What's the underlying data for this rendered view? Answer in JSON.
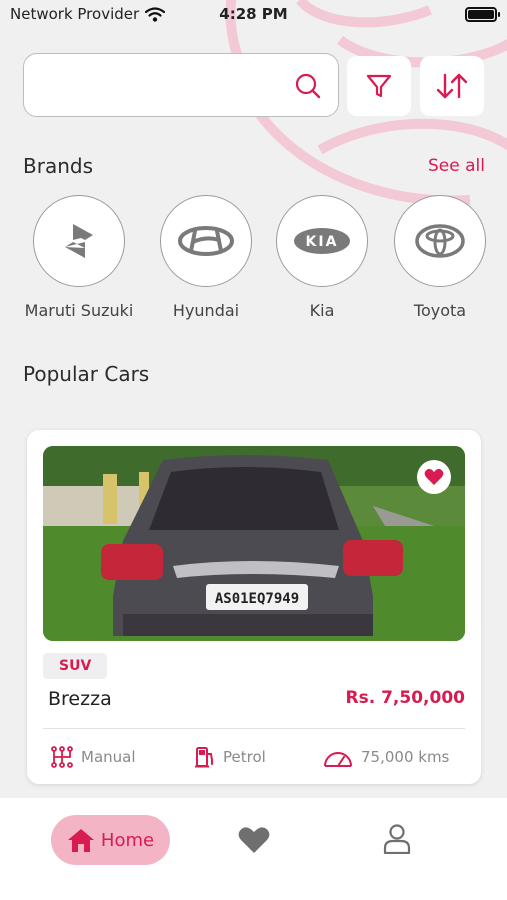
{
  "status_bar": {
    "provider": "Network Provider",
    "time": "4:28 PM"
  },
  "search": {
    "value": "",
    "placeholder": ""
  },
  "brands": {
    "title": "Brands",
    "see_all": "See all",
    "items": [
      {
        "label": "Maruti Suzuki",
        "icon": "suzuki-logo-icon"
      },
      {
        "label": "Hyundai",
        "icon": "hyundai-logo-icon"
      },
      {
        "label": "Kia",
        "icon": "kia-logo-icon",
        "logo_text": "KIA"
      },
      {
        "label": "Toyota",
        "icon": "toyota-logo-icon"
      }
    ]
  },
  "popular": {
    "title": "Popular Cars",
    "cars": [
      {
        "type": "SUV",
        "name": "Brezza",
        "price": "Rs. 7,50,000",
        "transmission": "Manual",
        "fuel": "Petrol",
        "mileage": "75,000 kms",
        "plate": "AS01EQ7949",
        "favorite": true
      }
    ]
  },
  "nav": {
    "home_label": "Home"
  },
  "colors": {
    "accent": "#d81b50",
    "accent_soft": "#f3b5c6",
    "background": "#f0f0f0"
  }
}
